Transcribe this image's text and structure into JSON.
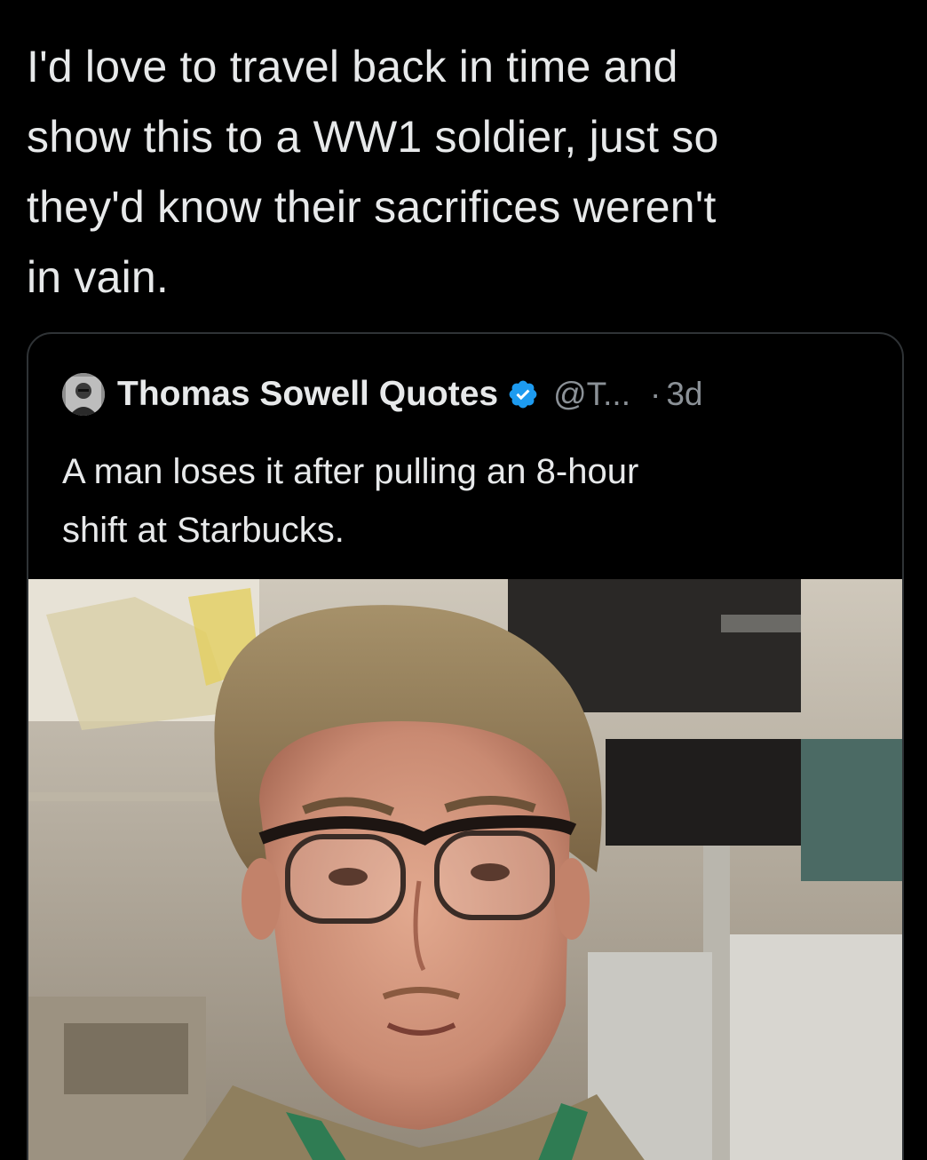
{
  "post": {
    "text_lines": [
      "I'd love to travel back in time and",
      "show this to a WW1 soldier, just so",
      "they'd know their sacrifices weren't",
      "in vain."
    ]
  },
  "quoted_post": {
    "author_name": "Thomas Sowell Quotes",
    "verified_icon": "verified-badge-icon",
    "handle": "@T...",
    "separator": "·",
    "time": "3d",
    "text_lines": [
      "A man loses it after pulling an 8-hour",
      "shift at Starbucks."
    ],
    "media": {
      "kind": "video-thumbnail"
    }
  },
  "colors": {
    "background": "#000000",
    "text_primary": "#e7e9ea",
    "text_secondary": "#8b9197",
    "border": "#2f3336",
    "verified_blue": "#1d9bf0"
  }
}
